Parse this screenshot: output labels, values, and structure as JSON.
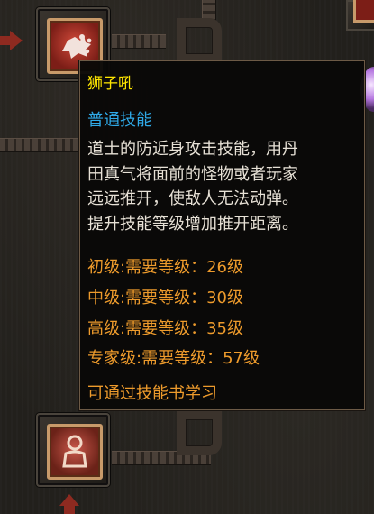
{
  "skill_panel": {
    "icons": [
      "lion-roar-skill-icon",
      "locked-skill-icon"
    ]
  },
  "tooltip": {
    "title": "狮子吼",
    "type": "普通技能",
    "description": "道士的防近身攻击技能，用丹\n田真气将面前的怪物或者玩家\n远远推开，使敌人无法动弹。\n提升技能等级增加推开距离。",
    "requirements": [
      {
        "label": "初级:需要等级：26级"
      },
      {
        "label": "中级:需要等级：30级"
      },
      {
        "label": "高级:需要等级：35级"
      },
      {
        "label": "专家级:需要等级：57级"
      }
    ],
    "footer": "可通过技能书学习",
    "colors": {
      "title": "#ffe600",
      "type": "#2fa9e7",
      "description": "#e7e1d6",
      "requirement": "#ee9b2c"
    }
  }
}
